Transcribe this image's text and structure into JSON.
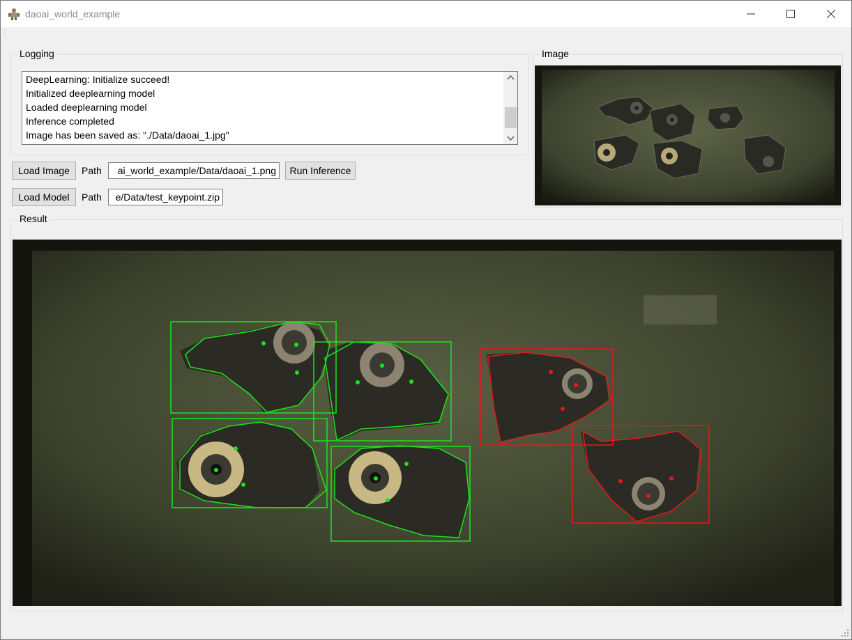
{
  "window": {
    "title": "daoai_world_example"
  },
  "logging": {
    "label": "Logging",
    "lines": [
      "DeepLearning: Initialize succeed!",
      "Initialized deeplearning model",
      "Loaded deeplearning model",
      "Inference completed",
      "Image has been saved as: \"./Data/daoai_1.jpg\""
    ]
  },
  "image_panel": {
    "label": "Image"
  },
  "controls": {
    "load_image_label": "Load Image",
    "image_path_label": "Path",
    "image_path_value": "ai_world_example/Data/daoai_1.png",
    "run_inference_label": "Run Inference",
    "load_model_label": "Load Model",
    "model_path_label": "Path",
    "model_path_value": "e/Data/test_keypoint.zip"
  },
  "result_panel": {
    "label": "Result"
  },
  "colors": {
    "green_detection": "#19e619",
    "red_detection": "#e61919",
    "background": "#f0f0f0"
  },
  "icons": [
    "app-icon",
    "minimize-icon",
    "maximize-icon",
    "close-icon",
    "scroll-up-icon",
    "scroll-down-icon",
    "resize-grip-icon"
  ]
}
